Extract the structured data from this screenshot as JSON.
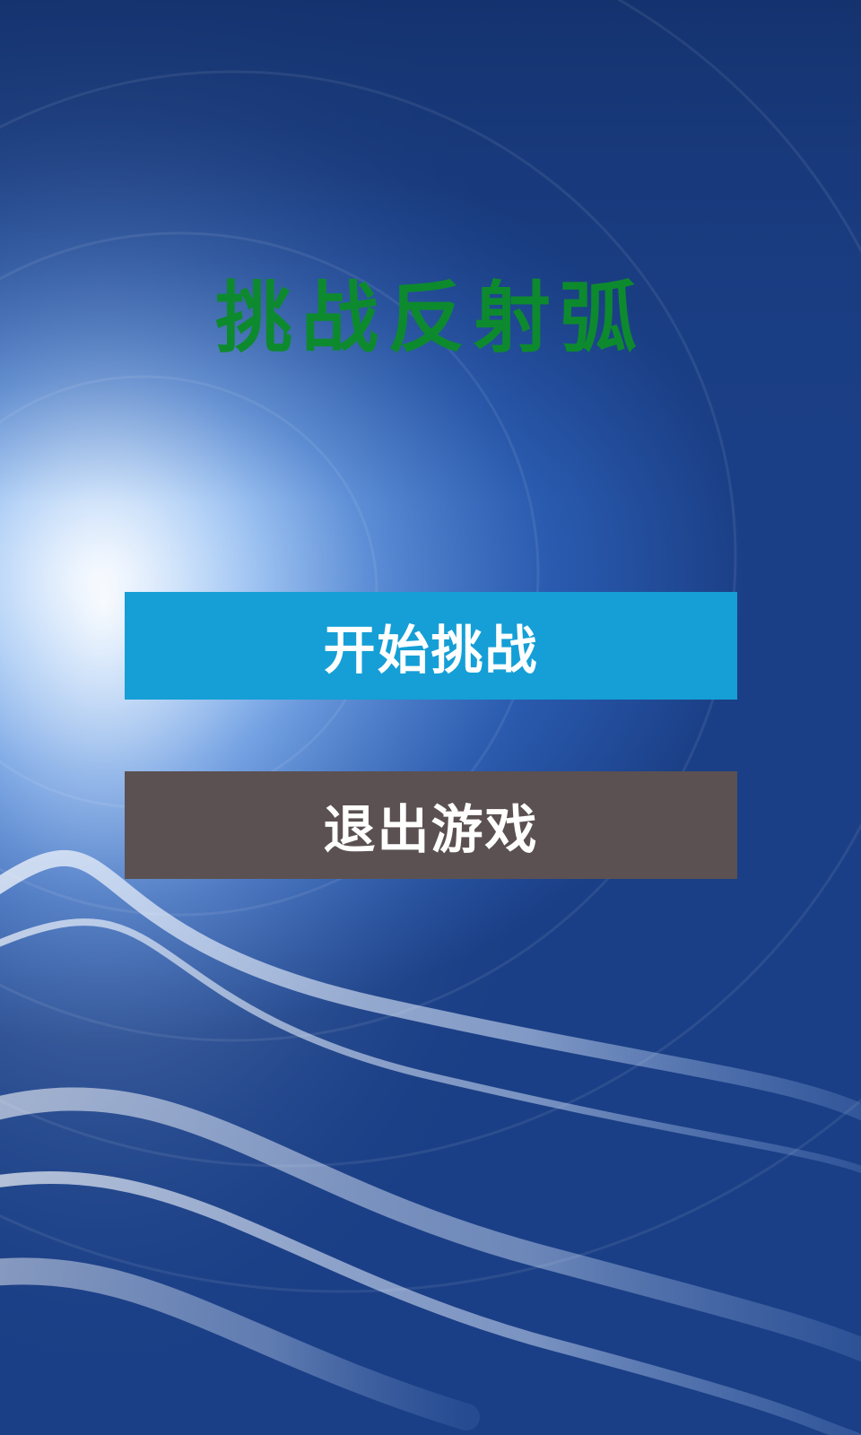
{
  "game": {
    "title": "挑战反射弧",
    "start_button_label": "开始挑战",
    "quit_button_label": "退出游戏"
  },
  "colors": {
    "title": "#0d8a2e",
    "start_button_bg": "#159fd6",
    "quit_button_bg": "#5b5152",
    "button_text": "#ffffff"
  },
  "background": {
    "description_icon": "light-tunnel-background"
  }
}
